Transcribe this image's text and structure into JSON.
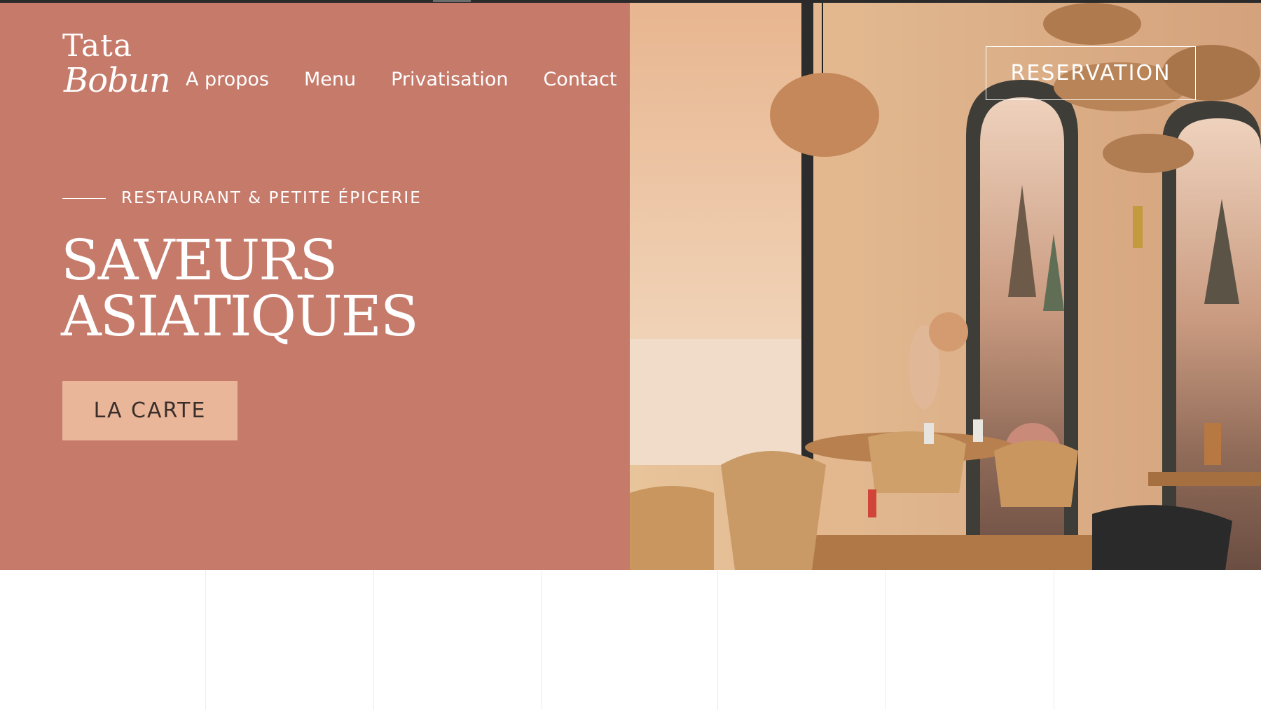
{
  "brand": {
    "line1": "Tata",
    "line2": "Bobun"
  },
  "nav": {
    "items": [
      {
        "label": "A propos"
      },
      {
        "label": "Menu"
      },
      {
        "label": "Privatisation"
      },
      {
        "label": "Contact"
      }
    ]
  },
  "reservation_label": "RESERVATION",
  "hero": {
    "eyebrow": "RESTAURANT & PETITE ÉPICERIE",
    "title_line1": "SAVEURS",
    "title_line2": "ASIATIQUES",
    "cta_label": "LA CARTE"
  },
  "colors": {
    "hero_background": "#c57a6a",
    "cta_background": "#eab69a",
    "text_on_hero": "#ffffff"
  }
}
